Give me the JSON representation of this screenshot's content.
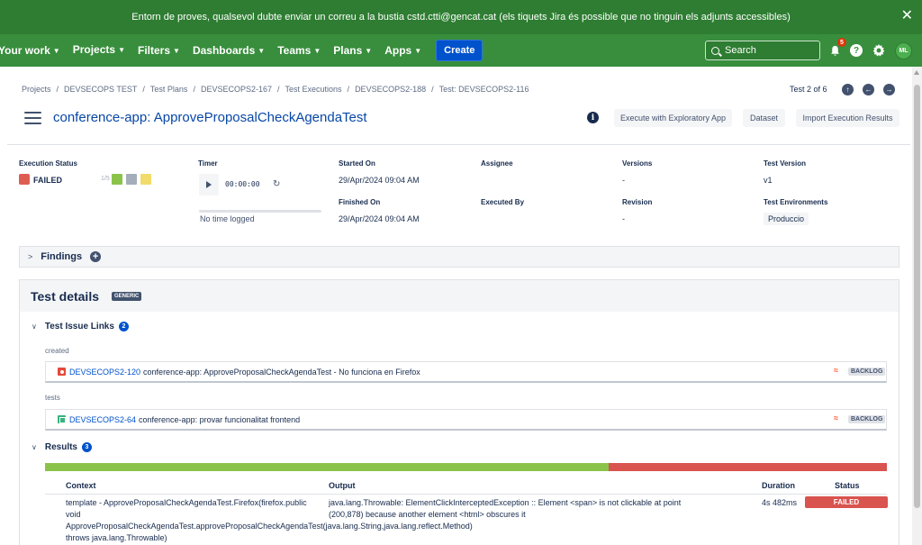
{
  "banner": {
    "message": "Entorn de proves, qualsevol dubte enviar un correu a la bustia cstd.ctti@gencat.cat (els tiquets Jira és possible que no tinguin els adjunts accessibles)",
    "close_icon": "close-icon"
  },
  "nav": {
    "items": [
      {
        "label": "Your work"
      },
      {
        "label": "Projects"
      },
      {
        "label": "Filters"
      },
      {
        "label": "Dashboards"
      },
      {
        "label": "Teams"
      },
      {
        "label": "Plans"
      },
      {
        "label": "Apps"
      }
    ],
    "create_label": "Create",
    "search_placeholder": "Search",
    "notifications_count": "5",
    "avatar_initials": "ML"
  },
  "breadcrumb": [
    "Projects",
    "DEVSECOPS TEST",
    "Test Plans",
    "DEVSECOPS2-167",
    "Test Executions",
    "DEVSECOPS2-188",
    "Test: DEVSECOPS2-116"
  ],
  "pager": {
    "label": "Test 2 of 6"
  },
  "header": {
    "title": "conference-app: ApproveProposalCheckAgendaTest",
    "buttons": {
      "exploratory": "Execute with Exploratory App",
      "dataset": "Dataset",
      "import": "Import Execution Results"
    }
  },
  "fields": {
    "execution_status_label": "Execution Status",
    "execution_status_value": "FAILED",
    "status_fraction": "1/5",
    "status_colors": [
      "#8bc34a",
      "#a5adba",
      "#f0db6b"
    ],
    "timer_label": "Timer",
    "timer_value": "00:00:00",
    "no_time": "No time logged",
    "started_label": "Started On",
    "started_value": "29/Apr/2024 09:04 AM",
    "finished_label": "Finished On",
    "finished_value": "29/Apr/2024 09:04 AM",
    "assignee_label": "Assignee",
    "executed_by_label": "Executed By",
    "versions_label": "Versions",
    "versions_value": "-",
    "revision_label": "Revision",
    "revision_value": "-",
    "test_version_label": "Test Version",
    "test_version_value": "v1",
    "test_env_label": "Test Environments",
    "test_env_value": "Produccio"
  },
  "findings": {
    "title": "Findings"
  },
  "details": {
    "title": "Test details",
    "badge": "GENERIC",
    "issue_links": {
      "title": "Test Issue Links",
      "count": "2",
      "groups": [
        {
          "type": "created",
          "key": "DEVSECOPS2-120",
          "summary": "conference-app: ApproveProposalCheckAgendaTest - No funciona en Firefox",
          "status": "BACKLOG",
          "icon": "bug-icon"
        },
        {
          "type": "tests",
          "key": "DEVSECOPS2-64",
          "summary": "conference-app: provar funcionalitat frontend",
          "status": "BACKLOG",
          "icon": "story-icon"
        }
      ]
    },
    "results": {
      "title": "Results",
      "count": "3",
      "pass_fraction": 0.67,
      "fail_fraction": 0.33,
      "columns": [
        "Context",
        "Output",
        "Duration",
        "Status"
      ],
      "rows": [
        {
          "context": "template - ApproveProposalCheckAgendaTest.Firefox(firefox.public void ApproveProposalCheckAgendaTest.approveProposalCheckAgendaTest(java.lang.String,java.lang.reflect.Method) throws java.lang.Throwable)",
          "output": "java.lang.Throwable: ElementClickInterceptedException :: Element <span> is not clickable at point (200,878) because another element <html> obscures it",
          "duration": "4s 482ms",
          "status": "FAILED"
        }
      ]
    }
  }
}
